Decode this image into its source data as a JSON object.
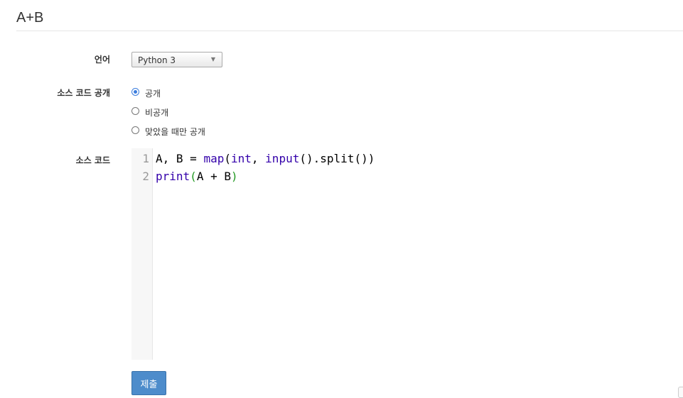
{
  "page": {
    "title": "A+B"
  },
  "language": {
    "label": "언어",
    "selected": "Python 3"
  },
  "visibility": {
    "label": "소스 코드 공개",
    "options": [
      {
        "label": "공개",
        "checked": true
      },
      {
        "label": "비공개",
        "checked": false
      },
      {
        "label": "맞았을 때만 공개",
        "checked": false
      }
    ]
  },
  "source": {
    "label": "소스 코드",
    "line_numbers": [
      "1",
      "2"
    ],
    "lines": [
      "A, B = map(int, input().split())",
      "print(A + B)"
    ]
  },
  "submit": {
    "label": "제출"
  },
  "colors": {
    "accent": "#3b7ddd",
    "button": "#4d8ccb",
    "keyword": "#3300aa",
    "bracket": "#229922"
  }
}
